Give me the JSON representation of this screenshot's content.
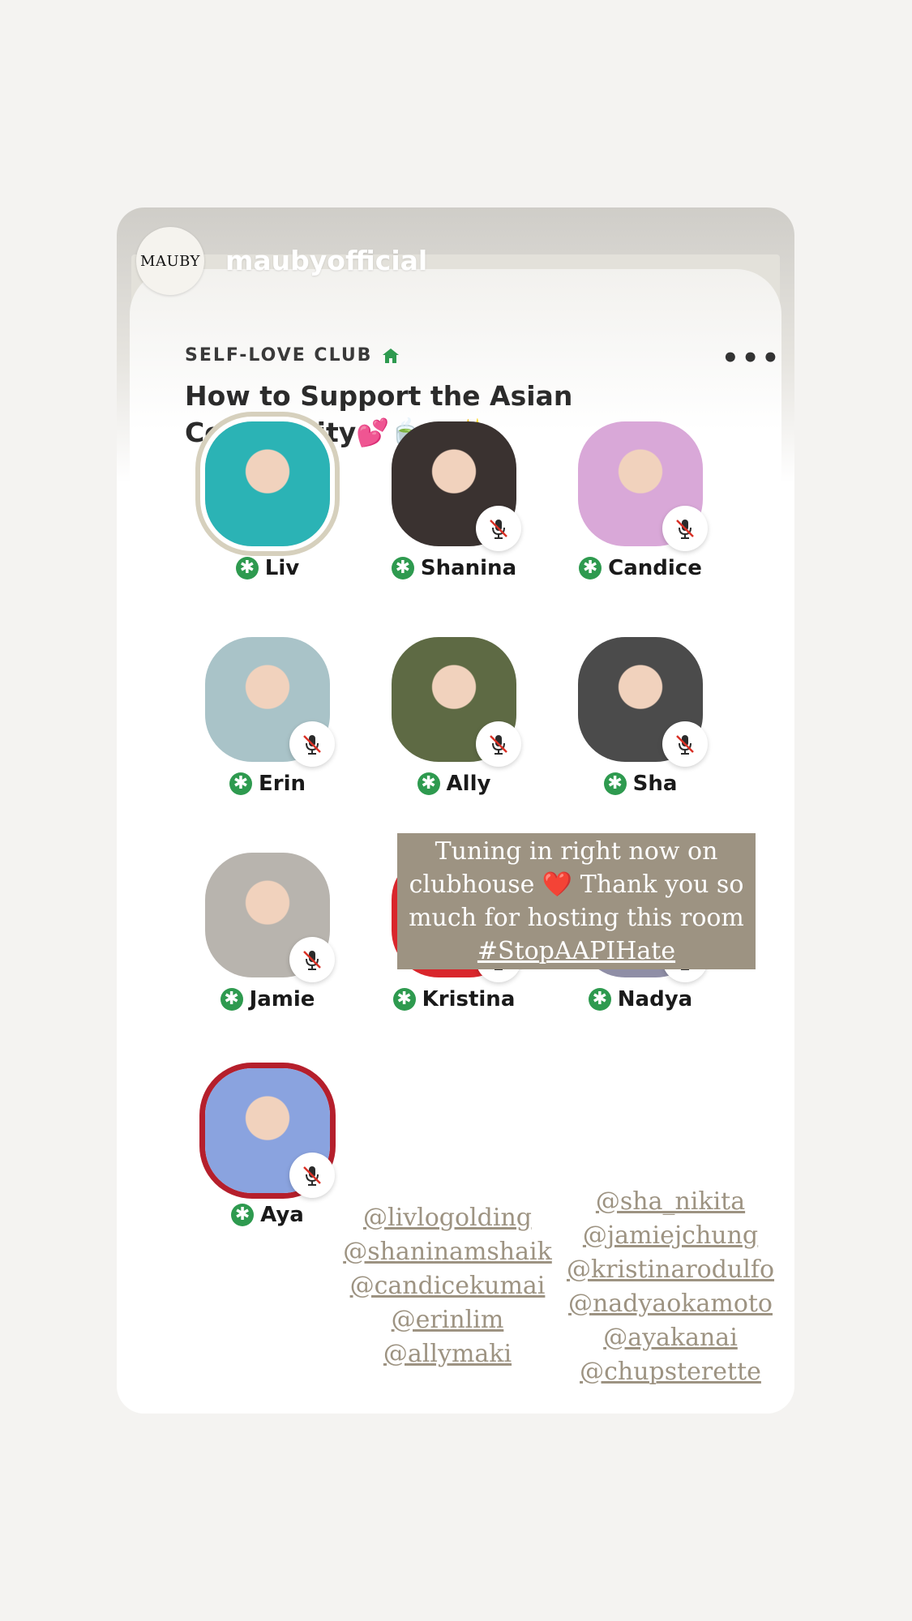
{
  "story": {
    "logo_text": "MAUBY",
    "username": "maubyofficial"
  },
  "room": {
    "club_name": "SELF-LOVE CLUB",
    "title": "How to Support the Asian Community💕🍵🫖✨",
    "more_label": "•••"
  },
  "speakers": [
    {
      "name": "Liv",
      "muted": false,
      "color": "#2bb3b5"
    },
    {
      "name": "Shanina",
      "muted": true,
      "color": "#3a3230"
    },
    {
      "name": "Candice",
      "muted": true,
      "color": "#d9a8d8"
    },
    {
      "name": "Erin",
      "muted": true,
      "color": "#a9c3c8"
    },
    {
      "name": "Ally",
      "muted": true,
      "color": "#5e6a44"
    },
    {
      "name": "Sha",
      "muted": true,
      "color": "#4b4b4b"
    },
    {
      "name": "Jamie",
      "muted": true,
      "color": "#b8b4ae"
    },
    {
      "name": "Kristina",
      "muted": true,
      "color": "#d9262c"
    },
    {
      "name": "Nadya",
      "muted": true,
      "color": "#8f8ea6"
    },
    {
      "name": "Aya",
      "muted": true,
      "color": "#8aa3df"
    }
  ],
  "note": {
    "line1": "Tuning in right now on",
    "line2": "clubhouse ❤️ Thank you so",
    "line3": "much for hosting this room",
    "hashtag": "#StopAAPIHate"
  },
  "mentions_left": [
    "@livlogolding",
    "@shaninamshaik",
    "@candicekumai",
    "@erinlim",
    "@allymaki"
  ],
  "mentions_right": [
    "@sha_nikita",
    "@jamiejchung",
    "@kristinarodulfo",
    "@nadyaokamoto",
    "@ayakanai",
    "@chupsterette"
  ],
  "colors": {
    "moderator_badge": "#2e9a4f",
    "note_bg": "#9d9382",
    "mute_slash": "#d93025"
  }
}
